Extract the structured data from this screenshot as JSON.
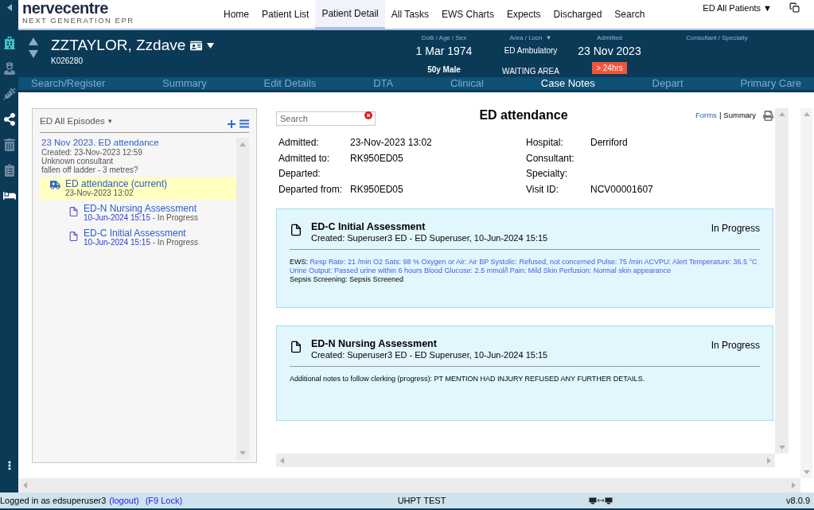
{
  "logo": {
    "name": "nervecentre",
    "tagline": "NEXT GENERATION EPR"
  },
  "nav": [
    {
      "label": "Home",
      "selected": false
    },
    {
      "label": "Patient List",
      "selected": false
    },
    {
      "label": "Patient Detail",
      "selected": true
    },
    {
      "label": "All Tasks",
      "selected": false
    },
    {
      "label": "EWS Charts",
      "selected": false
    },
    {
      "label": "Expects",
      "selected": false
    },
    {
      "label": "Discharged",
      "selected": false
    },
    {
      "label": "Search",
      "selected": false
    }
  ],
  "patient_list_selector": "ED All Patients ▼",
  "patient": {
    "name": "ZZTAYLOR, Zzdave",
    "id": "K026280",
    "dob_label": "DoB / Age / Sex",
    "dob": "1 Mar 1974",
    "age_sex": "50y Male",
    "area_label": "Area / Locn",
    "area_caret": "▼",
    "area": "ED Ambulatory",
    "location": "WAITING AREA",
    "admitted_label": "Admitted",
    "admitted": "23 Nov 2023",
    "stay_badge": "> 24hrs",
    "consultant_label": "Consultant / Specialty"
  },
  "tabs": [
    {
      "label": "Search/Register",
      "selected": false
    },
    {
      "label": "Summary",
      "selected": false
    },
    {
      "label": "Edit Details",
      "selected": false
    },
    {
      "label": "DTA",
      "selected": false
    },
    {
      "label": "Clinical",
      "selected": false
    },
    {
      "label": "Case Notes",
      "selected": true
    },
    {
      "label": "Depart",
      "selected": false
    },
    {
      "label": "Primary Care",
      "selected": false
    }
  ],
  "episodes_panel": {
    "title": "ED All Episodes",
    "caret": "▾",
    "episodes": [
      {
        "title": "23 Nov 2023. ED attendance",
        "details": [
          "Created: 23-Nov-2023 12:59",
          "Unknown consultant",
          "fallen off ladder - 3 metres?"
        ],
        "children": [
          {
            "title": "ED attendance (current)",
            "date": "23-Nov-2023 13:02",
            "selected": true,
            "children": [
              {
                "title": "ED-N Nursing Assessment",
                "date": "10-Jun-2024 15:15",
                "status": " - In Progress",
                "selected": false
              },
              {
                "title": "ED-C Initial Assessment",
                "date": "10-Jun-2024 15:15",
                "status": " - In Progress",
                "selected": false
              }
            ]
          }
        ]
      }
    ]
  },
  "search": {
    "placeholder": "Search"
  },
  "attendance": {
    "title": "ED attendance",
    "links": [
      {
        "label": "Forms",
        "selected": false
      },
      {
        "label": "Summary",
        "selected": true
      }
    ],
    "separator": "|",
    "fields_left": [
      {
        "label": "Admitted:",
        "value": "23-Nov-2023 13:02"
      },
      {
        "label": "Admitted to:",
        "value": "RK950ED05"
      },
      {
        "label": "Departed:"
      },
      {
        "label": "Departed from:",
        "value": "RK950ED05"
      }
    ],
    "fields_right": [
      {
        "label": "Hospital:",
        "value": "Derriford"
      },
      {
        "label": "Consultant:"
      },
      {
        "label": "Specialty:"
      },
      {
        "label": "Visit ID:",
        "value": "NCV00001607"
      }
    ]
  },
  "forms": [
    {
      "title": "ED-C Initial Assessment",
      "created": "Created: Superuser3 ED - ED Superuser, 10-Jun-2024 15:15",
      "status": "In Progress",
      "lines": [
        {
          "kind": "labeled",
          "label": "EWS:",
          "value": "Resp Rate: 21 /min O2 Sats: 98 % Oxygen or Air: Air BP Systolic: Refused, not concerned Pulse: 75 /min ACVPU: Alert Temperature: 36.5 °C Urine Output: Passed urine within 6 hours Blood Glucose: 2.5 mmol/l Pain: Mild Skin Perfusion: Normal skin appearance"
        },
        {
          "kind": "plain",
          "text": "Sepsis Screening: Sepsis Screened"
        }
      ]
    },
    {
      "title": "ED-N Nursing Assessment",
      "created": "Created: Superuser3 ED - ED Superuser, 10-Jun-2024 15:15",
      "status": "In Progress",
      "lines": [
        {
          "kind": "plain",
          "text": "Additional notes to follow clerking (progress): PT MENTION HAD INJURY REFUSED ANY FURTHER DETAILS."
        }
      ]
    }
  ],
  "status_bar": {
    "login": "Logged in as edsuperuser3",
    "logout": "(logout)",
    "lock": "(F9 Lock)",
    "environment": "UHPT TEST",
    "version": "v8.0.9"
  }
}
